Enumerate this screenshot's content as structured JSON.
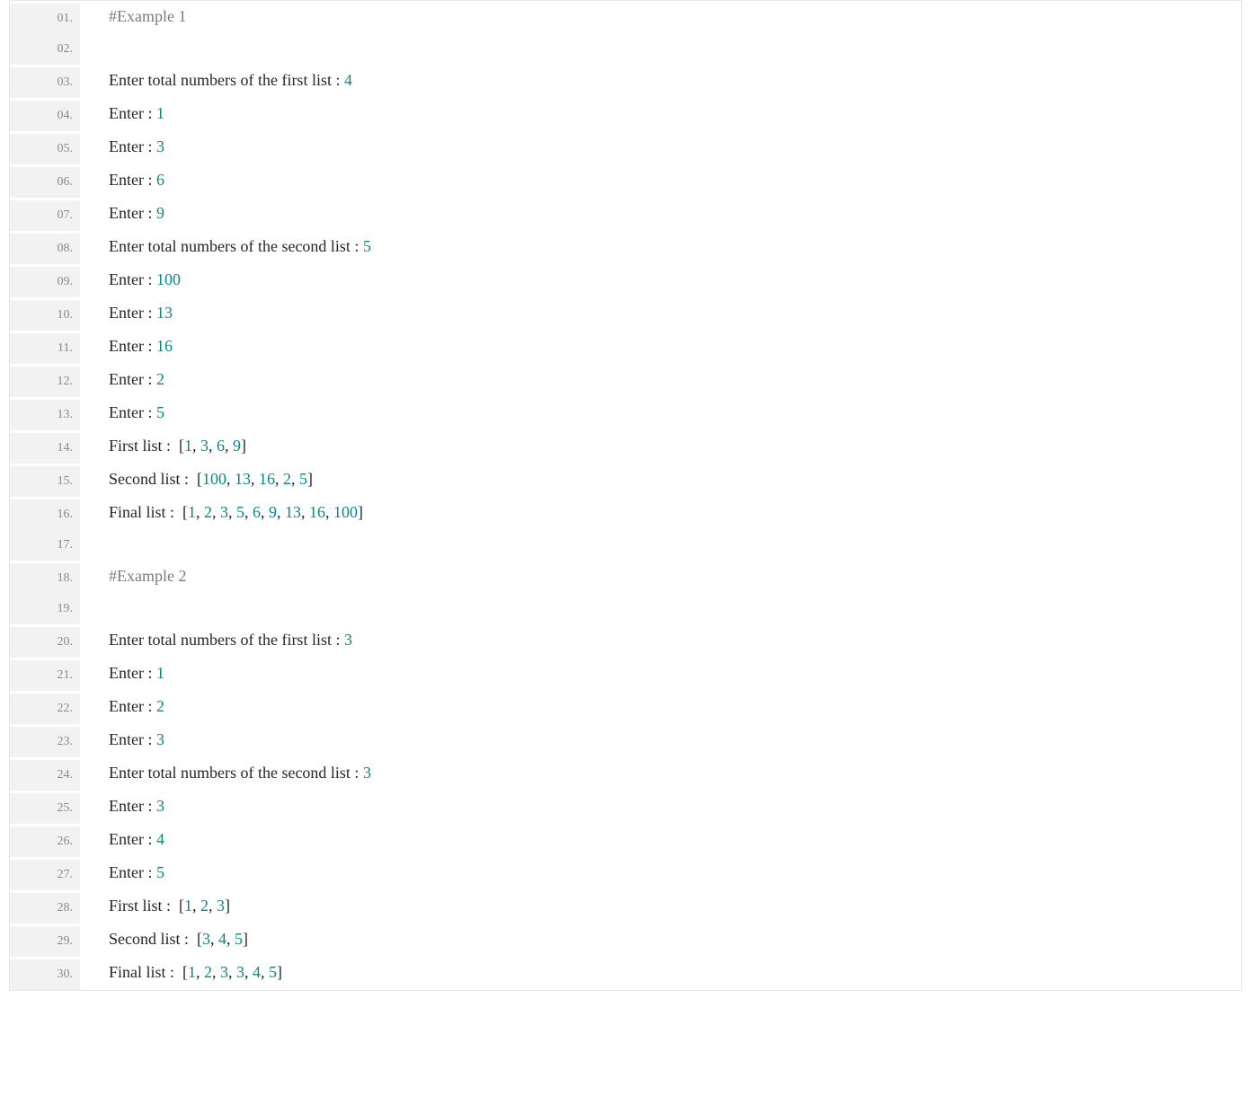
{
  "colors": {
    "text": "#262626",
    "number": "#0b8686",
    "comment": "#7d7d7d",
    "gutter_bg": "#f2f2f2",
    "gutter_fg": "#8a8a8a",
    "border": "#e8e8e8"
  },
  "lines": [
    {
      "n": "01.",
      "tokens": [
        {
          "t": "#Example 1",
          "c": "comment"
        }
      ]
    },
    {
      "n": "02.",
      "tokens": []
    },
    {
      "n": "03.",
      "tokens": [
        {
          "t": "Enter total numbers of the first list : ",
          "c": "text"
        },
        {
          "t": "4",
          "c": "num"
        }
      ]
    },
    {
      "n": "04.",
      "tokens": [
        {
          "t": "Enter : ",
          "c": "text"
        },
        {
          "t": "1",
          "c": "num"
        }
      ]
    },
    {
      "n": "05.",
      "tokens": [
        {
          "t": "Enter : ",
          "c": "text"
        },
        {
          "t": "3",
          "c": "num"
        }
      ]
    },
    {
      "n": "06.",
      "tokens": [
        {
          "t": "Enter : ",
          "c": "text"
        },
        {
          "t": "6",
          "c": "num"
        }
      ]
    },
    {
      "n": "07.",
      "tokens": [
        {
          "t": "Enter : ",
          "c": "text"
        },
        {
          "t": "9",
          "c": "num"
        }
      ]
    },
    {
      "n": "08.",
      "tokens": [
        {
          "t": "Enter total numbers of the second list : ",
          "c": "text"
        },
        {
          "t": "5",
          "c": "num"
        }
      ]
    },
    {
      "n": "09.",
      "tokens": [
        {
          "t": "Enter : ",
          "c": "text"
        },
        {
          "t": "100",
          "c": "num"
        }
      ]
    },
    {
      "n": "10.",
      "tokens": [
        {
          "t": "Enter : ",
          "c": "text"
        },
        {
          "t": "13",
          "c": "num"
        }
      ]
    },
    {
      "n": "11.",
      "tokens": [
        {
          "t": "Enter : ",
          "c": "text"
        },
        {
          "t": "16",
          "c": "num"
        }
      ]
    },
    {
      "n": "12.",
      "tokens": [
        {
          "t": "Enter : ",
          "c": "text"
        },
        {
          "t": "2",
          "c": "num"
        }
      ]
    },
    {
      "n": "13.",
      "tokens": [
        {
          "t": "Enter : ",
          "c": "text"
        },
        {
          "t": "5",
          "c": "num"
        }
      ]
    },
    {
      "n": "14.",
      "tokens": [
        {
          "t": "First list :  [",
          "c": "text"
        },
        {
          "t": "1",
          "c": "num"
        },
        {
          "t": ", ",
          "c": "text"
        },
        {
          "t": "3",
          "c": "num"
        },
        {
          "t": ", ",
          "c": "text"
        },
        {
          "t": "6",
          "c": "num"
        },
        {
          "t": ", ",
          "c": "text"
        },
        {
          "t": "9",
          "c": "num"
        },
        {
          "t": "]",
          "c": "text"
        }
      ]
    },
    {
      "n": "15.",
      "tokens": [
        {
          "t": "Second list :  [",
          "c": "text"
        },
        {
          "t": "100",
          "c": "num"
        },
        {
          "t": ", ",
          "c": "text"
        },
        {
          "t": "13",
          "c": "num"
        },
        {
          "t": ", ",
          "c": "text"
        },
        {
          "t": "16",
          "c": "num"
        },
        {
          "t": ", ",
          "c": "text"
        },
        {
          "t": "2",
          "c": "num"
        },
        {
          "t": ", ",
          "c": "text"
        },
        {
          "t": "5",
          "c": "num"
        },
        {
          "t": "]",
          "c": "text"
        }
      ]
    },
    {
      "n": "16.",
      "tokens": [
        {
          "t": "Final list :  [",
          "c": "text"
        },
        {
          "t": "1",
          "c": "num"
        },
        {
          "t": ", ",
          "c": "text"
        },
        {
          "t": "2",
          "c": "num"
        },
        {
          "t": ", ",
          "c": "text"
        },
        {
          "t": "3",
          "c": "num"
        },
        {
          "t": ", ",
          "c": "text"
        },
        {
          "t": "5",
          "c": "num"
        },
        {
          "t": ", ",
          "c": "text"
        },
        {
          "t": "6",
          "c": "num"
        },
        {
          "t": ", ",
          "c": "text"
        },
        {
          "t": "9",
          "c": "num"
        },
        {
          "t": ", ",
          "c": "text"
        },
        {
          "t": "13",
          "c": "num"
        },
        {
          "t": ", ",
          "c": "text"
        },
        {
          "t": "16",
          "c": "num"
        },
        {
          "t": ", ",
          "c": "text"
        },
        {
          "t": "100",
          "c": "num"
        },
        {
          "t": "]",
          "c": "text"
        }
      ]
    },
    {
      "n": "17.",
      "tokens": []
    },
    {
      "n": "18.",
      "tokens": [
        {
          "t": "#Example 2",
          "c": "comment"
        }
      ]
    },
    {
      "n": "19.",
      "tokens": []
    },
    {
      "n": "20.",
      "tokens": [
        {
          "t": "Enter total numbers of the first list : ",
          "c": "text"
        },
        {
          "t": "3",
          "c": "num"
        }
      ]
    },
    {
      "n": "21.",
      "tokens": [
        {
          "t": "Enter : ",
          "c": "text"
        },
        {
          "t": "1",
          "c": "num"
        }
      ]
    },
    {
      "n": "22.",
      "tokens": [
        {
          "t": "Enter : ",
          "c": "text"
        },
        {
          "t": "2",
          "c": "num"
        }
      ]
    },
    {
      "n": "23.",
      "tokens": [
        {
          "t": "Enter : ",
          "c": "text"
        },
        {
          "t": "3",
          "c": "num"
        }
      ]
    },
    {
      "n": "24.",
      "tokens": [
        {
          "t": "Enter total numbers of the second list : ",
          "c": "text"
        },
        {
          "t": "3",
          "c": "num"
        }
      ]
    },
    {
      "n": "25.",
      "tokens": [
        {
          "t": "Enter : ",
          "c": "text"
        },
        {
          "t": "3",
          "c": "num"
        }
      ]
    },
    {
      "n": "26.",
      "tokens": [
        {
          "t": "Enter : ",
          "c": "text"
        },
        {
          "t": "4",
          "c": "num"
        }
      ]
    },
    {
      "n": "27.",
      "tokens": [
        {
          "t": "Enter : ",
          "c": "text"
        },
        {
          "t": "5",
          "c": "num"
        }
      ]
    },
    {
      "n": "28.",
      "tokens": [
        {
          "t": "First list :  [",
          "c": "text"
        },
        {
          "t": "1",
          "c": "num"
        },
        {
          "t": ", ",
          "c": "text"
        },
        {
          "t": "2",
          "c": "num"
        },
        {
          "t": ", ",
          "c": "text"
        },
        {
          "t": "3",
          "c": "num"
        },
        {
          "t": "]",
          "c": "text"
        }
      ]
    },
    {
      "n": "29.",
      "tokens": [
        {
          "t": "Second list :  [",
          "c": "text"
        },
        {
          "t": "3",
          "c": "num"
        },
        {
          "t": ", ",
          "c": "text"
        },
        {
          "t": "4",
          "c": "num"
        },
        {
          "t": ", ",
          "c": "text"
        },
        {
          "t": "5",
          "c": "num"
        },
        {
          "t": "]",
          "c": "text"
        }
      ]
    },
    {
      "n": "30.",
      "tokens": [
        {
          "t": "Final list :  [",
          "c": "text"
        },
        {
          "t": "1",
          "c": "num"
        },
        {
          "t": ", ",
          "c": "text"
        },
        {
          "t": "2",
          "c": "num"
        },
        {
          "t": ", ",
          "c": "text"
        },
        {
          "t": "3",
          "c": "num"
        },
        {
          "t": ", ",
          "c": "text"
        },
        {
          "t": "3",
          "c": "num"
        },
        {
          "t": ", ",
          "c": "text"
        },
        {
          "t": "4",
          "c": "num"
        },
        {
          "t": ", ",
          "c": "text"
        },
        {
          "t": "5",
          "c": "num"
        },
        {
          "t": "]",
          "c": "text"
        }
      ]
    }
  ]
}
